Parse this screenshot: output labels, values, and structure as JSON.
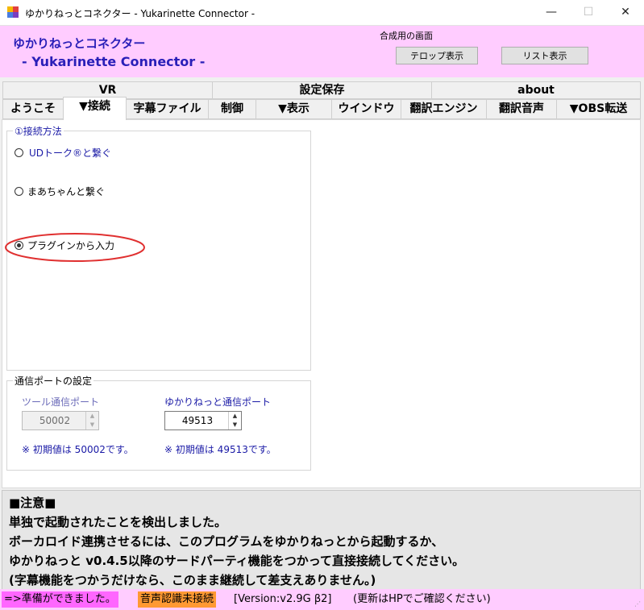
{
  "window": {
    "title": "ゆかりねっとコネクター - Yukarinette Connector -",
    "minimize": "—",
    "maximize": "☐",
    "close": "✕"
  },
  "header": {
    "title_jp": "ゆかりねっとコネクター",
    "title_en": "- Yukarinette Connector -",
    "compose_label": "合成用の画面",
    "telop_button": "テロップ表示",
    "list_button": "リスト表示",
    "background_color": "#ffccff",
    "title_color": "#2a1fb8"
  },
  "tabs": {
    "row1": [
      "VR",
      "設定保存",
      "about"
    ],
    "row2": [
      "ようこそ",
      "▼接続",
      "字幕ファイル",
      "制御",
      "▼表示",
      "ウインドウ",
      "翻訳エンジン",
      "翻訳音声",
      "▼OBS転送"
    ],
    "active": "▼接続"
  },
  "connection": {
    "group_label": "①接続方法",
    "options": [
      {
        "label": "UDトーク®と繋ぐ",
        "selected": false
      },
      {
        "label": "まあちゃんと繋ぐ",
        "selected": false
      },
      {
        "label": "プラグインから入力",
        "selected": true
      }
    ],
    "highlight_color": "#e03030"
  },
  "ports": {
    "group_label": "通信ポートの設定",
    "tool_label": "ツール通信ポート",
    "tool_value": "50002",
    "tool_note": "※ 初期値は 50002です。",
    "yukari_label": "ゆかりねっと通信ポート",
    "yukari_value": "49513",
    "yukari_note": "※ 初期値は 49513です。"
  },
  "notice": {
    "heading": "■注意■",
    "lines": [
      "単独で起動されたことを検出しました。",
      "ボーカロイド連携させるには、このプログラムをゆかりねっとから起動するか、",
      "ゆかりねっと v0.4.5以降のサードパーティ機能をつかって直接接続してください。",
      "(字幕機能をつかうだけなら、このまま継続して差支えありません。)"
    ]
  },
  "status": {
    "ready": "=>準備ができました。",
    "speech": "音声認識未接続",
    "version": "[Version:v2.9G β2]",
    "update": "(更新はHPでご確認ください)",
    "speech_color": "#ff9933",
    "ready_color": "#ff66ff"
  }
}
